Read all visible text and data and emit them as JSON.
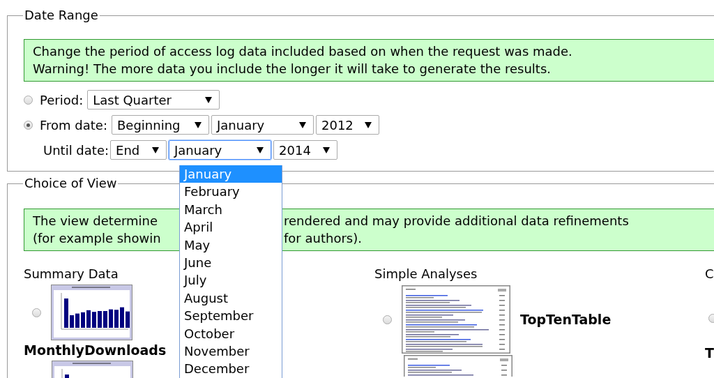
{
  "date_range": {
    "legend": "Date Range",
    "notice": [
      "Change the period of access log data included based on when the request was made.",
      "Warning! The more data you include the longer it will take to generate the results."
    ],
    "rows": [
      {
        "kind": "radio",
        "label": "Period:",
        "selected": false,
        "selects": [
          {
            "value": "Last Quarter",
            "focused": false
          }
        ]
      },
      {
        "kind": "radio",
        "label": "From date:",
        "selected": true,
        "selects": [
          {
            "value": "Beginning",
            "focused": false
          },
          {
            "value": "January",
            "focused": false
          },
          {
            "value": "2012",
            "focused": false
          }
        ]
      },
      {
        "kind": "plain",
        "label": "Until date:",
        "selects": [
          {
            "value": "End",
            "focused": false
          },
          {
            "value": "January",
            "focused": true
          },
          {
            "value": "2014",
            "focused": false
          }
        ]
      }
    ]
  },
  "month_dropdown": {
    "options": [
      {
        "label": "January",
        "selected": true
      },
      {
        "label": "February",
        "selected": false
      },
      {
        "label": "March",
        "selected": false
      },
      {
        "label": "April",
        "selected": false
      },
      {
        "label": "May",
        "selected": false
      },
      {
        "label": "June",
        "selected": false
      },
      {
        "label": "July",
        "selected": false
      },
      {
        "label": "August",
        "selected": false
      },
      {
        "label": "September",
        "selected": false
      },
      {
        "label": "October",
        "selected": false
      },
      {
        "label": "November",
        "selected": false
      },
      {
        "label": "December",
        "selected": false
      }
    ]
  },
  "choice_of_view": {
    "legend": "Choice of View",
    "notice": [
      [
        "The view determine",
        "rendered and may provide additional data refinements"
      ],
      [
        "(for example showin",
        "for authors)."
      ]
    ],
    "columns": [
      {
        "heading": "Summary Data",
        "items": [
          {
            "kind": "chart",
            "label": "MonthlyDownloads",
            "selected": false,
            "label_below": true
          }
        ],
        "more_thumbnails": [
          {
            "kind": "chart"
          }
        ]
      },
      {
        "heading": "Simple Analyses",
        "items": [
          {
            "kind": "table",
            "label": "TopTenTable",
            "selected": false,
            "label_below": false
          }
        ],
        "more_thumbnails": [
          {
            "kind": "table"
          }
        ]
      },
      {
        "heading": "C",
        "items": [
          {
            "kind": "none",
            "label": "T",
            "selected": false,
            "label_below": true
          }
        ]
      }
    ]
  }
}
